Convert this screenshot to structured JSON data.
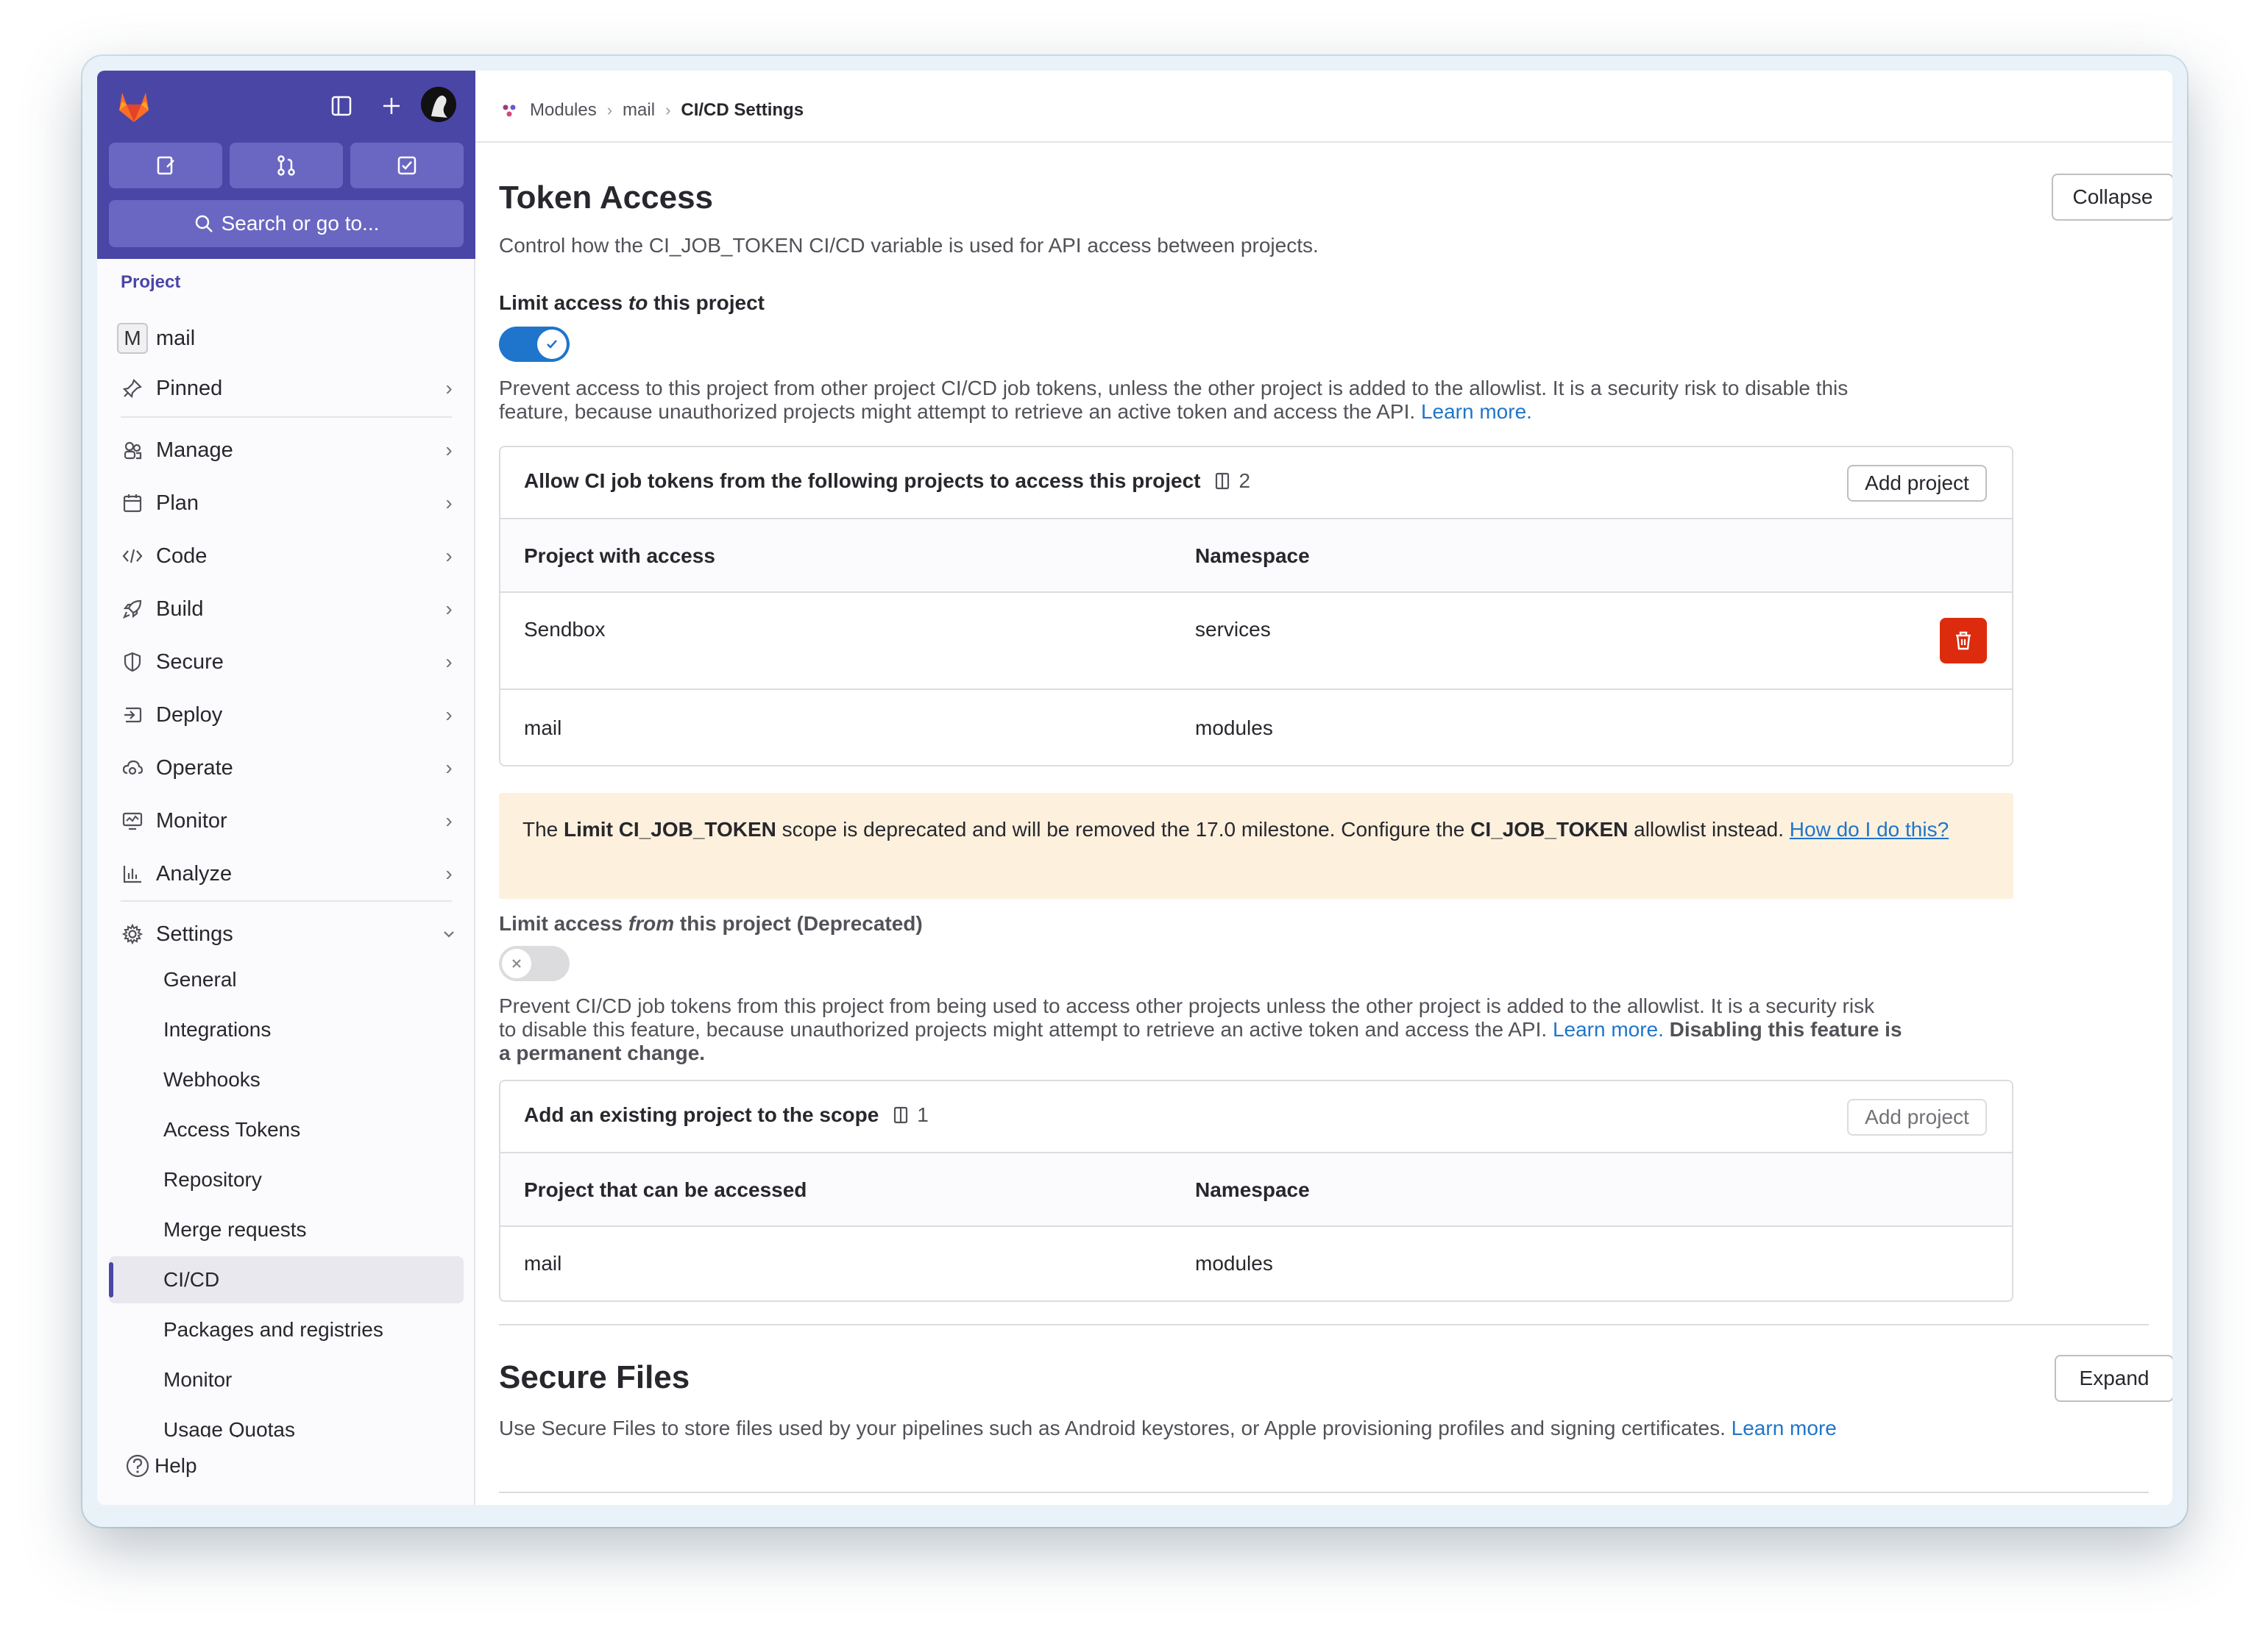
{
  "sidebar": {
    "search_label": "Search or go to...",
    "section_label": "Project",
    "project_initial": "M",
    "project_name": "mail",
    "items": [
      {
        "label": "Pinned"
      },
      {
        "label": "Manage"
      },
      {
        "label": "Plan"
      },
      {
        "label": "Code"
      },
      {
        "label": "Build"
      },
      {
        "label": "Secure"
      },
      {
        "label": "Deploy"
      },
      {
        "label": "Operate"
      },
      {
        "label": "Monitor"
      },
      {
        "label": "Analyze"
      },
      {
        "label": "Settings"
      }
    ],
    "settings_sub": [
      {
        "label": "General"
      },
      {
        "label": "Integrations"
      },
      {
        "label": "Webhooks"
      },
      {
        "label": "Access Tokens"
      },
      {
        "label": "Repository"
      },
      {
        "label": "Merge requests"
      },
      {
        "label": "CI/CD"
      },
      {
        "label": "Packages and registries"
      },
      {
        "label": "Monitor"
      },
      {
        "label": "Usage Quotas"
      }
    ],
    "help_label": "Help",
    "accent_color": "#4a46a6"
  },
  "breadcrumb": {
    "items": [
      "Modules",
      "mail",
      "CI/CD Settings"
    ]
  },
  "token_access": {
    "title": "Token Access",
    "description": "Control how the CI_JOB_TOKEN CI/CD variable is used for API access between projects.",
    "collapse_label": "Collapse",
    "limit_to_label_pre": "Limit access ",
    "limit_to_label_em": "to",
    "limit_to_label_post": " this project",
    "limit_to_enabled": true,
    "limit_to_help_line1": "Prevent access to this project from other project CI/CD job tokens, unless the other project is added to the allowlist. It is a security risk to disable this",
    "limit_to_help_line2": "feature, because unauthorized projects might attempt to retrieve an active token and access the API.",
    "learn_more": "Learn more.",
    "allow_card": {
      "title": "Allow CI job tokens from the following projects to access this project",
      "count": "2",
      "add_label": "Add project",
      "columns": [
        "Project with access",
        "Namespace"
      ],
      "rows": [
        {
          "project": "Sendbox",
          "namespace": "services"
        },
        {
          "project": "mail",
          "namespace": "modules"
        }
      ]
    },
    "alert": {
      "t1": "The ",
      "b1": "Limit CI_JOB_TOKEN",
      "t2": " scope is deprecated and will be removed the 17.0 milestone. Configure the ",
      "b2": "CI_JOB_TOKEN",
      "t3": " allowlist instead. ",
      "link": "How do I do this?"
    },
    "limit_from_label_pre": "Limit access ",
    "limit_from_label_em": "from",
    "limit_from_label_post": " this project (Deprecated)",
    "limit_from_enabled": false,
    "limit_from_help_line1": "Prevent CI/CD job tokens from this project from being used to access other projects unless the other project is added to the allowlist. It is a security risk",
    "limit_from_help_line2": "to disable this feature, because unauthorized projects might attempt to retrieve an active token and access the API. ",
    "limit_from_learn_more": "Learn more.",
    "limit_from_bold_a": " Disabling this feature is",
    "limit_from_bold_b": "a permanent change.",
    "scope_card": {
      "title": "Add an existing project to the scope",
      "count": "1",
      "add_label": "Add project",
      "columns": [
        "Project that can be accessed",
        "Namespace"
      ],
      "rows": [
        {
          "project": "mail",
          "namespace": "modules"
        }
      ]
    }
  },
  "secure_files": {
    "title": "Secure Files",
    "expand_label": "Expand",
    "description": "Use Secure Files to store files used by your pipelines such as Android keystores, or Apple provisioning profiles and signing certificates.",
    "learn_more": "Learn more"
  }
}
